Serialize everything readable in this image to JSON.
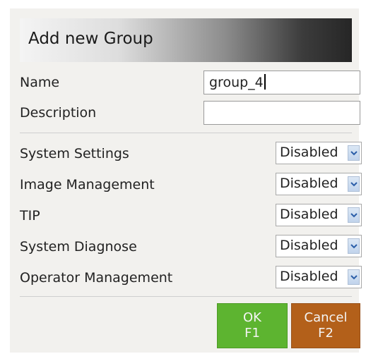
{
  "dialog": {
    "title": "Add new Group"
  },
  "fields": {
    "name_label": "Name",
    "name_value": "group_4",
    "description_label": "Description",
    "description_value": ""
  },
  "permissions": [
    {
      "label": "System Settings",
      "value": "Disabled"
    },
    {
      "label": "Image Management",
      "value": "Disabled"
    },
    {
      "label": "TIP",
      "value": "Disabled"
    },
    {
      "label": "System Diagnose",
      "value": "Disabled"
    },
    {
      "label": "Operator Management",
      "value": "Disabled"
    }
  ],
  "buttons": {
    "ok_label": "OK",
    "ok_key": "F1",
    "cancel_label": "Cancel",
    "cancel_key": "F2"
  },
  "icons": {
    "dropdown": "chevron-down-icon"
  },
  "colors": {
    "ok_button": "#5db430",
    "cancel_button": "#b3601a",
    "dialog_background": "#f2f1ee"
  }
}
